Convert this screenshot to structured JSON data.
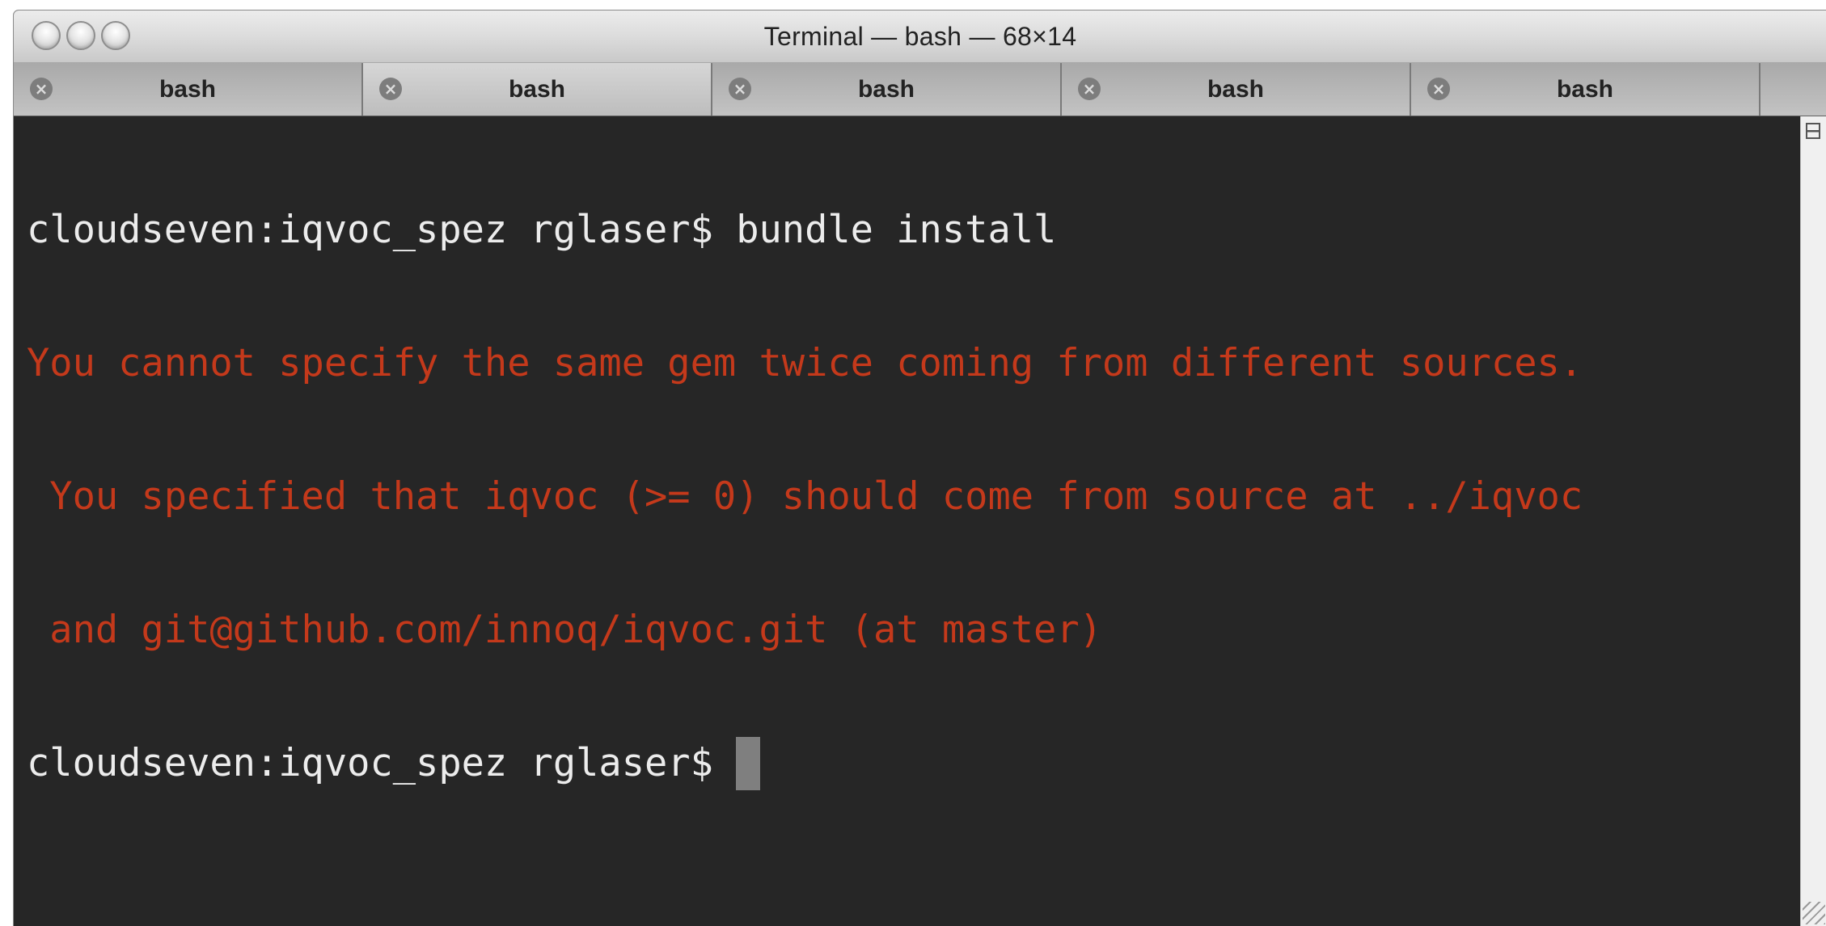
{
  "window": {
    "title": "Terminal — bash — 68×14"
  },
  "tabs": [
    {
      "label": "bash",
      "active": false,
      "close_icon": "×"
    },
    {
      "label": "bash",
      "active": true,
      "close_icon": "×"
    },
    {
      "label": "bash",
      "active": false,
      "close_icon": "×"
    },
    {
      "label": "bash",
      "active": false,
      "close_icon": "×"
    },
    {
      "label": "bash",
      "active": false,
      "close_icon": "×"
    }
  ],
  "terminal": {
    "lines": [
      {
        "text": "cloudseven:iqvoc_spez rglaser$ bundle install",
        "kind": "normal"
      },
      {
        "text": "You cannot specify the same gem twice coming from different sources.",
        "kind": "error"
      },
      {
        "text": " You specified that iqvoc (>= 0) should come from source at ../iqvoc",
        "kind": "error"
      },
      {
        "text": " and git@github.com/innoq/iqvoc.git (at master)",
        "kind": "error"
      },
      {
        "text": "cloudseven:iqvoc_spez rglaser$ ",
        "kind": "normal"
      }
    ],
    "colors": {
      "background": "#262626",
      "normal_text": "#ececec",
      "error_text": "#c4391b",
      "cursor": "#7f7f7f"
    }
  }
}
